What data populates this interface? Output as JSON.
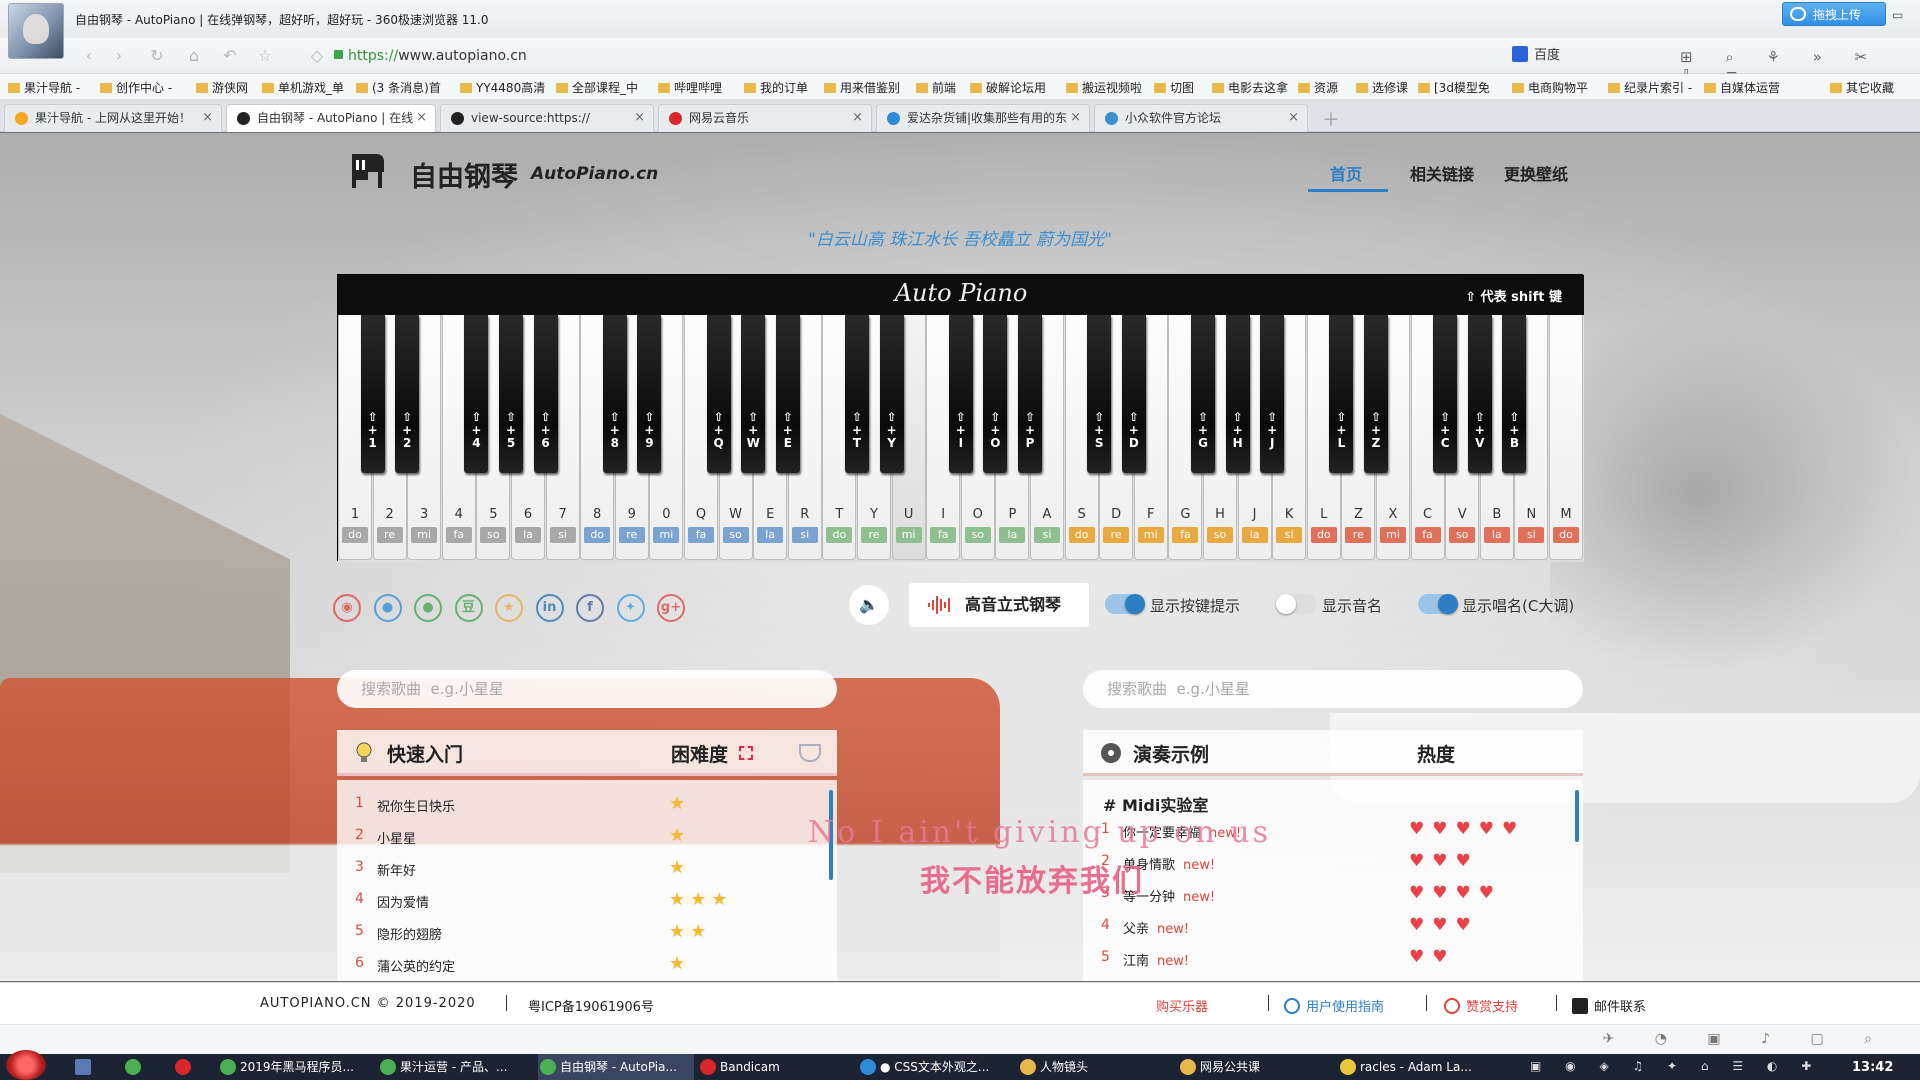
{
  "browser": {
    "window_title": "自由钢琴 - AutoPiano | 在线弹钢琴，超好听，超好玩 - 360极速浏览器 11.0",
    "upload_label": "拖拽上传",
    "url_scheme": "https://",
    "url_host": "www.autopiano.cn",
    "search_engine": "百度",
    "bookmarks": [
      "果汁导航 -",
      "创作中心 -",
      "游侠网",
      "单机游戏_单",
      "(3 条消息)首",
      "YY4480高清",
      "全部课程_中",
      "哔哩哔哩",
      "我的订单",
      "用来借鉴别",
      "前端",
      "破解论坛用",
      "搬运视频啦",
      "切图",
      "电影去这拿",
      "资源",
      "选修课",
      "[3d模型免",
      "电商购物平",
      "纪录片索引 -",
      "自媒体运营",
      "其它收藏"
    ],
    "tabs": [
      {
        "label": "果汁导航 - 上网从这里开始！",
        "fav_color": "#f5a623"
      },
      {
        "label": "自由钢琴 - AutoPiano | 在线",
        "fav_color": "#222222",
        "active": true
      },
      {
        "label": "view-source:https://",
        "fav_color": "#222222"
      },
      {
        "label": "网易云音乐",
        "fav_color": "#d8262a"
      },
      {
        "label": "爱达杂货铺|收集那些有用的东",
        "fav_color": "#2e8bd8"
      },
      {
        "label": "小众软件官方论坛",
        "fav_color": "#3b8fd1"
      }
    ]
  },
  "site": {
    "name": "自由钢琴",
    "name_en": "AutoPiano.cn",
    "nav": [
      "首页",
      "相关链接",
      "更换壁纸"
    ],
    "slogan": "\"白云山高 珠江水长 吾校矗立 蔚为国光\""
  },
  "piano": {
    "brand": "Auto Piano",
    "shift_tip": "⇧ 代表 shift 键",
    "white_keys": [
      {
        "k": "1",
        "n": "do"
      },
      {
        "k": "2",
        "n": "re"
      },
      {
        "k": "3",
        "n": "mi"
      },
      {
        "k": "4",
        "n": "fa"
      },
      {
        "k": "5",
        "n": "so"
      },
      {
        "k": "6",
        "n": "la"
      },
      {
        "k": "7",
        "n": "si"
      },
      {
        "k": "8",
        "n": "do"
      },
      {
        "k": "9",
        "n": "re"
      },
      {
        "k": "0",
        "n": "mi"
      },
      {
        "k": "Q",
        "n": "fa"
      },
      {
        "k": "W",
        "n": "so"
      },
      {
        "k": "E",
        "n": "la"
      },
      {
        "k": "R",
        "n": "si"
      },
      {
        "k": "T",
        "n": "do"
      },
      {
        "k": "Y",
        "n": "re"
      },
      {
        "k": "U",
        "n": "mi"
      },
      {
        "k": "I",
        "n": "fa"
      },
      {
        "k": "O",
        "n": "so"
      },
      {
        "k": "P",
        "n": "la"
      },
      {
        "k": "A",
        "n": "si"
      },
      {
        "k": "S",
        "n": "do"
      },
      {
        "k": "D",
        "n": "re"
      },
      {
        "k": "F",
        "n": "mi"
      },
      {
        "k": "G",
        "n": "fa"
      },
      {
        "k": "H",
        "n": "so"
      },
      {
        "k": "J",
        "n": "la"
      },
      {
        "k": "K",
        "n": "si"
      },
      {
        "k": "L",
        "n": "do"
      },
      {
        "k": "Z",
        "n": "re"
      },
      {
        "k": "X",
        "n": "mi"
      },
      {
        "k": "C",
        "n": "fa"
      },
      {
        "k": "V",
        "n": "so"
      },
      {
        "k": "B",
        "n": "la"
      },
      {
        "k": "N",
        "n": "si"
      },
      {
        "k": "M",
        "n": "do"
      }
    ],
    "black_keys": [
      "1",
      "2",
      "4",
      "5",
      "6",
      "8",
      "9",
      "Q",
      "W",
      "E",
      "T",
      "Y",
      "I",
      "O",
      "P",
      "S",
      "D",
      "G",
      "H",
      "J",
      "L",
      "Z",
      "C",
      "V",
      "B"
    ],
    "pressed_key": "U",
    "octave_colors": [
      "#a8a8a8",
      "#7aa3cf",
      "#8fbf8f",
      "#e8a940",
      "#e0705a"
    ]
  },
  "controls": {
    "instrument": "高音立式钢琴",
    "toggle_keys": {
      "label": "显示按键提示",
      "on": true
    },
    "toggle_note": {
      "label": "显示音名",
      "on": false
    },
    "toggle_solfege": {
      "label": "显示唱名(C大调)",
      "on": true
    }
  },
  "search": {
    "left_placeholder": "搜索歌曲  e.g.小星星",
    "right_placeholder": "搜索歌曲  e.g.小星星"
  },
  "quickstart": {
    "title": "快速入门",
    "difficulty_label": "困难度",
    "songs": [
      {
        "num": "1",
        "name": "祝你生日快乐",
        "difficulty": 1
      },
      {
        "num": "2",
        "name": "小星星",
        "difficulty": 1
      },
      {
        "num": "3",
        "name": "新年好",
        "difficulty": 1
      },
      {
        "num": "4",
        "name": "因为爱情",
        "difficulty": 3
      },
      {
        "num": "5",
        "name": "隐形的翅膀",
        "difficulty": 2
      },
      {
        "num": "6",
        "name": "蒲公英的约定",
        "difficulty": 1
      }
    ]
  },
  "examples": {
    "title": "演奏示例",
    "heat_label": "热度",
    "category": "# Midi实验室",
    "new_tag": "new!",
    "songs": [
      {
        "num": "1",
        "name": "你一定要幸福",
        "heat": 5
      },
      {
        "num": "2",
        "name": "单身情歌",
        "heat": 3
      },
      {
        "num": "3",
        "name": "等一分钟",
        "heat": 4
      },
      {
        "num": "4",
        "name": "父亲",
        "heat": 3
      },
      {
        "num": "5",
        "name": "江南",
        "heat": 2
      }
    ]
  },
  "lyrics": {
    "en": "No I ain't giving up on us",
    "cn": "我不能放弃我们"
  },
  "footer": {
    "copyright": "AUTOPIANO.CN © 2019-2020",
    "icp": "粤ICP备19061906号",
    "buy": "购买乐器",
    "guide": "用户使用指南",
    "donate": "赞赏支持",
    "email": "邮件联系"
  },
  "taskbar": {
    "items": [
      {
        "label": "2019年黑马程序员...",
        "color": "#4caf50"
      },
      {
        "label": "果汁运营 - 产品、...",
        "color": "#4caf50"
      },
      {
        "label": "自由钢琴 - AutoPia...",
        "color": "#4caf50",
        "active": true
      },
      {
        "label": "Bandicam",
        "color": "#d8262a"
      },
      {
        "label": "● CSS文本外观之...",
        "color": "#2e8bd8"
      },
      {
        "label": "人物镜头",
        "color": "#e8b94a"
      },
      {
        "label": "网易公共课",
        "color": "#e8b94a"
      },
      {
        "label": "racles - Adam La...",
        "color": "#e8c83a"
      }
    ],
    "clock": "13:42"
  }
}
